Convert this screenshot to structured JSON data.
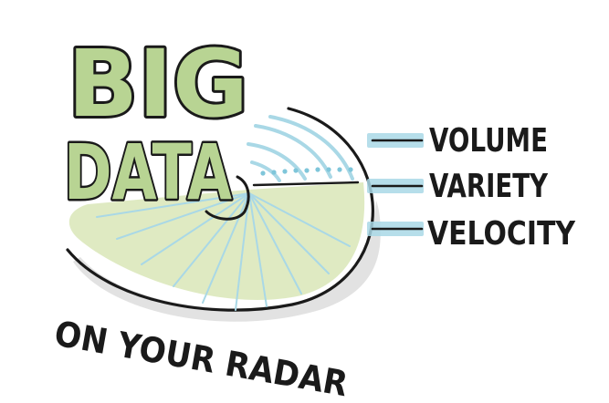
{
  "title": {
    "line1": "BIG",
    "line2": "DATA",
    "subtitle": "ON YOUR RADAR"
  },
  "labels": [
    "VOLUME",
    "VARIETY",
    "VELOCITY"
  ],
  "colors": {
    "title_fill": "#b8d493",
    "title_stroke": "#1a1a1a",
    "radar_wedge": "#dde9bf",
    "radar_lines": "#a9d8e6",
    "tab": "#a9d8e6",
    "ink": "#1a1a1a"
  }
}
